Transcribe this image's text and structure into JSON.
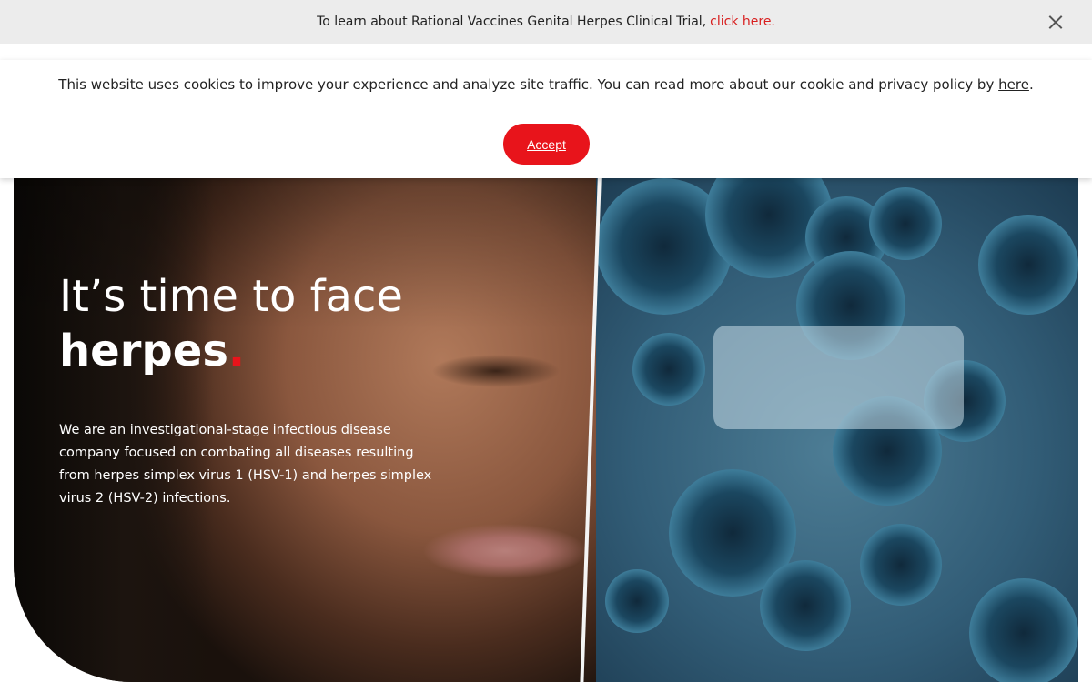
{
  "announcement": {
    "text": "To learn about Rational Vaccines Genital Herpes Clinical Trial,",
    "link": "click here."
  },
  "cookie_banner": {
    "message": "This website uses cookies to improve your experience and analyze site traffic. You can read more about our cookie and privacy policy by",
    "link": "here",
    "accept_label": "Accept"
  },
  "hero": {
    "headline_line1": "It’s time to face",
    "headline_line2": "herpes",
    "headline_dot": ".",
    "intro": "We are an investigational-stage infectious disease company focused on combating all diseases resulting from herpes simplex virus 1 (HSV-1) and herpes simplex virus 2 (HSV-2) infections."
  },
  "colors": {
    "accent": "#e8141b",
    "announcement_bg": "#ececec"
  },
  "icons": {
    "close": "close-icon"
  }
}
